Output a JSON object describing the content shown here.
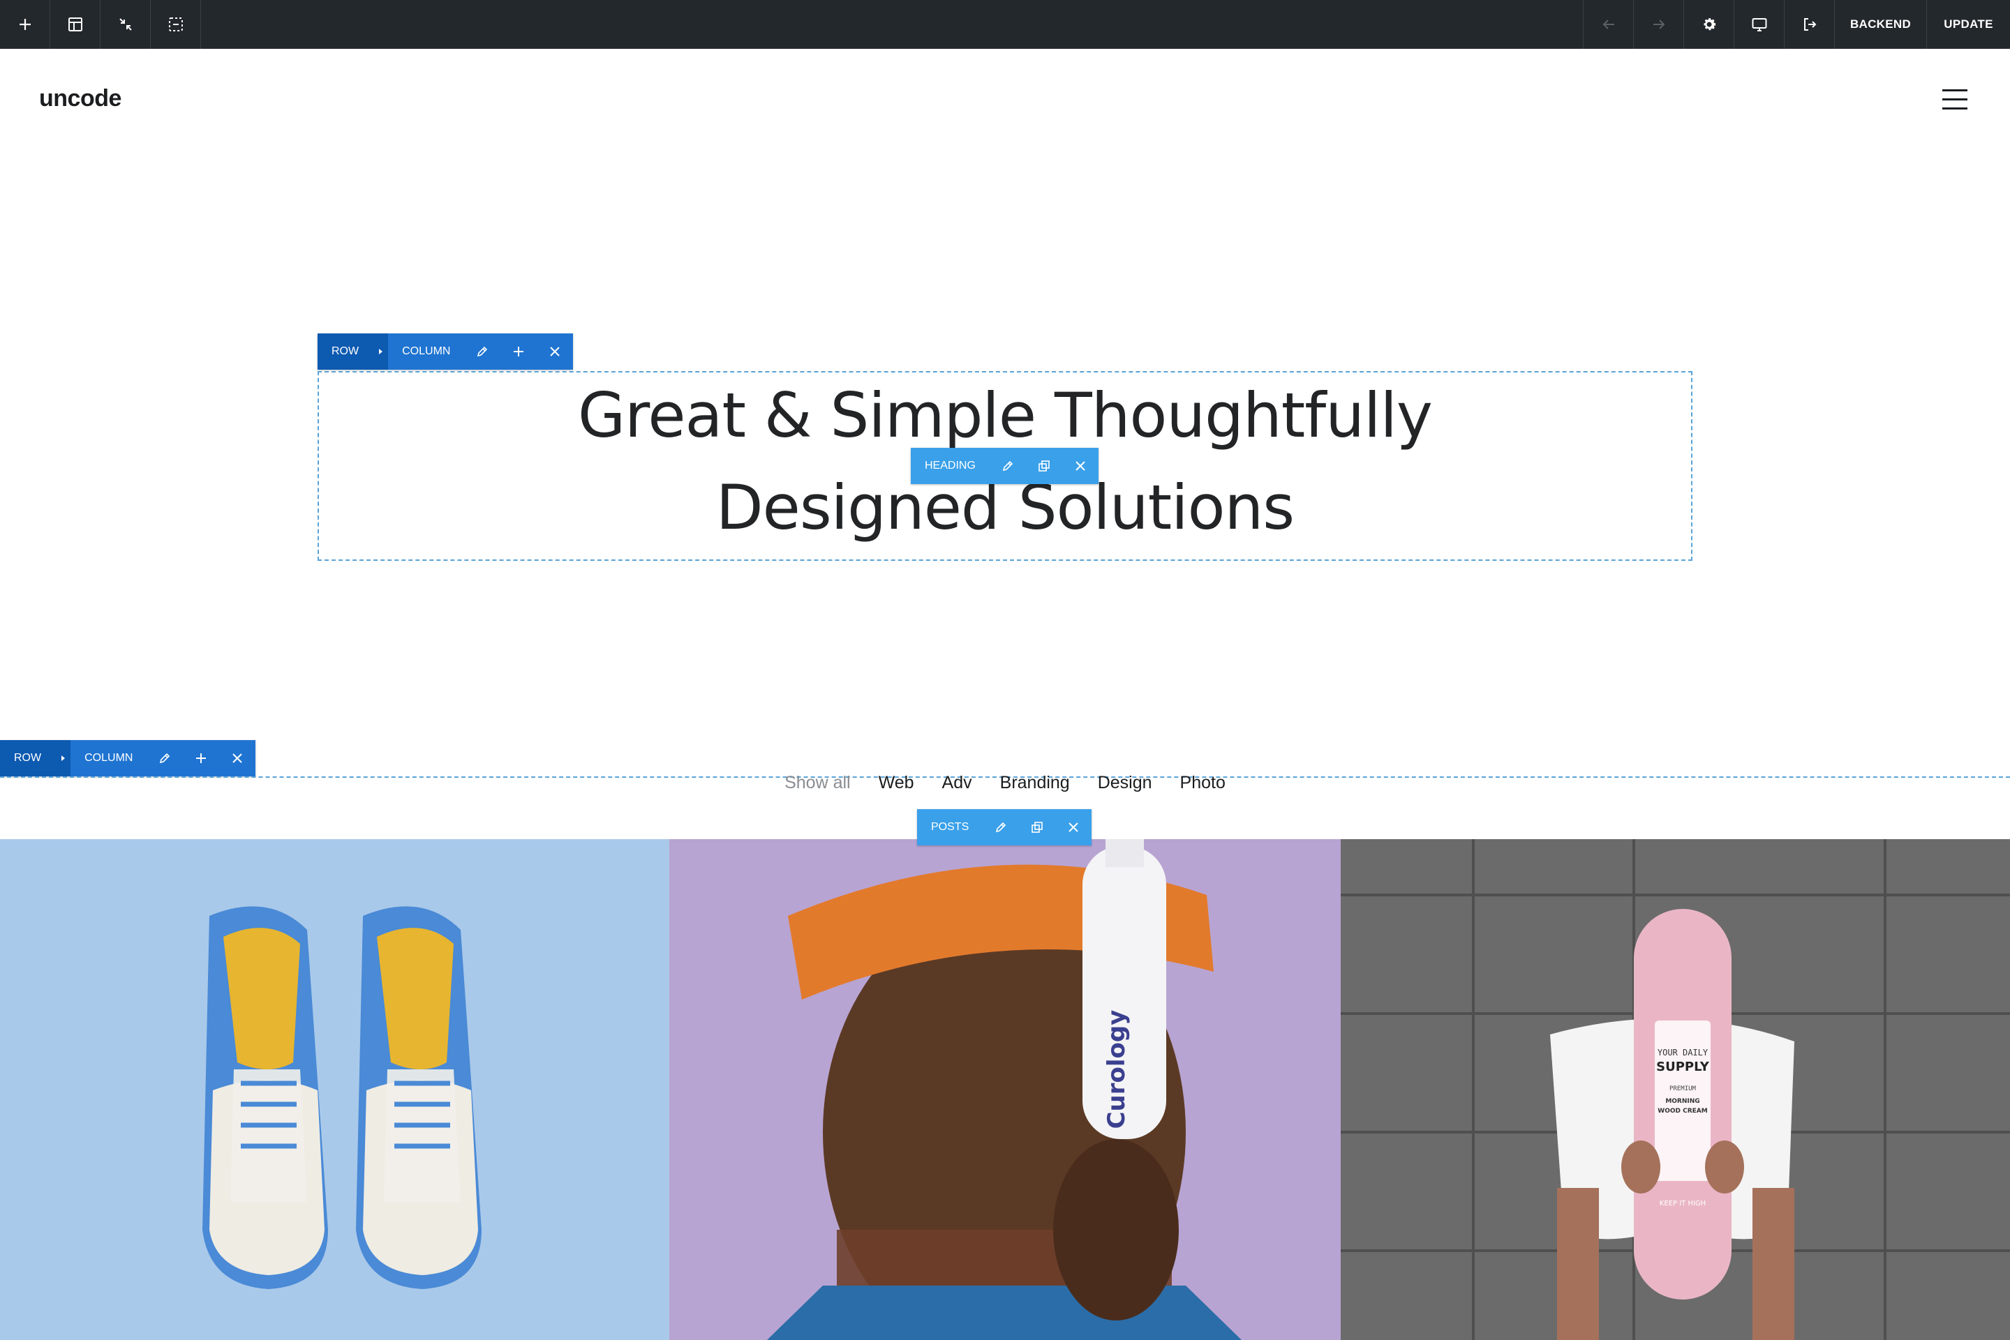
{
  "toolbar": {
    "left_icons": [
      "plus-icon",
      "layout-icon",
      "collapse-icon",
      "select-icon"
    ],
    "right_icons": [
      "undo-arrow-icon",
      "redo-arrow-icon",
      "gear-icon",
      "monitor-icon",
      "exit-icon"
    ],
    "backend_label": "BACKEND",
    "update_label": "UPDATE",
    "colors": {
      "background": "#23282d",
      "text": "#ffffff"
    }
  },
  "header": {
    "logo_text": "uncode",
    "menu_icon": "hamburger-icon"
  },
  "hero_controls": {
    "row_label": "ROW",
    "column_label": "COLUMN",
    "element_label": "HEADING"
  },
  "hero": {
    "line1": "Great & Simple Thoughtfully",
    "line2": "Designed Solutions"
  },
  "posts_controls": {
    "row_label": "ROW",
    "column_label": "COLUMN",
    "element_label": "POSTS"
  },
  "filters": {
    "items": [
      "Show all",
      "Web",
      "Adv",
      "Branding",
      "Design",
      "Photo"
    ],
    "active": "Show all"
  },
  "tiles": [
    {
      "subject": "blue sneakers top view",
      "bg": "#a9c9ea"
    },
    {
      "subject": "man holding bottle",
      "bottle_text": "Curology",
      "bg": "#b8a4d2"
    },
    {
      "subject": "person holding pink skateboard",
      "deck_text": [
        "YOUR DAILY",
        "SUPPLY",
        "PREMIUM",
        "MORNING",
        "WOOD CREAM",
        "KEEP IT HIGH"
      ],
      "bg": "#6d6d6d"
    }
  ],
  "colors": {
    "row_bar": "#0d5ab1",
    "column_bar": "#1f74d1",
    "element_bar": "#3aa0ea",
    "dash": "#5aa3d8"
  }
}
